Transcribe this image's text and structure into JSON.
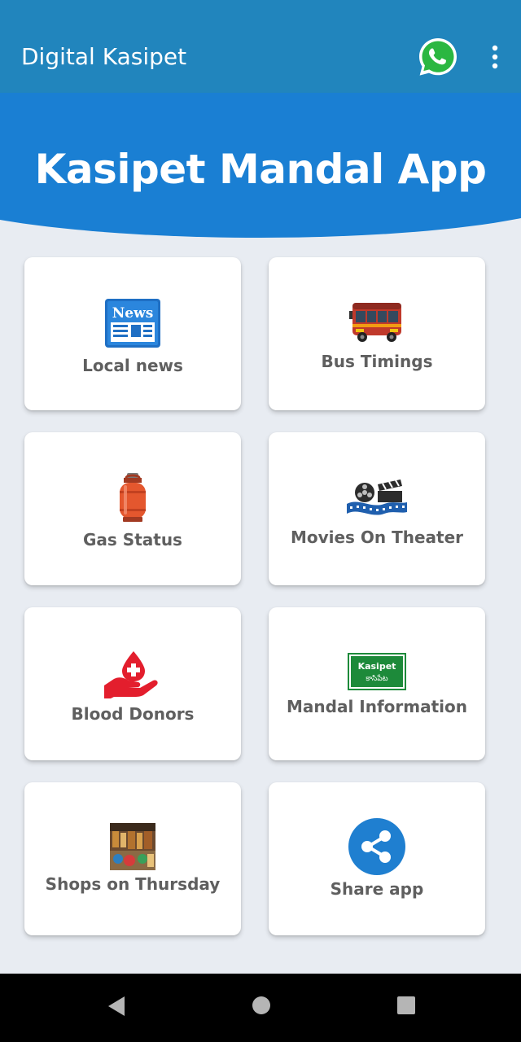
{
  "app_bar": {
    "title": "Digital Kasipet",
    "whatsapp_icon": "whatsapp-icon",
    "menu_icon": "more-vertical-icon"
  },
  "banner": {
    "title": "Kasipet Mandal App"
  },
  "tiles": [
    {
      "label": "Local news",
      "icon": "news-icon",
      "icon_text": "News"
    },
    {
      "label": "Bus Timings",
      "icon": "bus-icon"
    },
    {
      "label": "Gas Status",
      "icon": "gas-cylinder-icon"
    },
    {
      "label": "Movies On Theater",
      "icon": "film-reel-icon"
    },
    {
      "label": "Blood Donors",
      "icon": "blood-donation-icon"
    },
    {
      "label": "Mandal Information",
      "icon": "signboard-icon",
      "icon_text": "Kasipet",
      "icon_subtext": "కాసిపేట"
    },
    {
      "label": "Shops on Thursday",
      "icon": "market-photo-icon"
    },
    {
      "label": "Share app",
      "icon": "share-icon"
    }
  ],
  "nav_bar": {
    "back_icon": "back-triangle-icon",
    "home_icon": "home-circle-icon",
    "recents_icon": "recents-square-icon"
  },
  "colors": {
    "app_bar": "#2185bd",
    "banner": "#1a80d2",
    "label_text": "#5f5f5f",
    "background": "#e8ecf2"
  }
}
